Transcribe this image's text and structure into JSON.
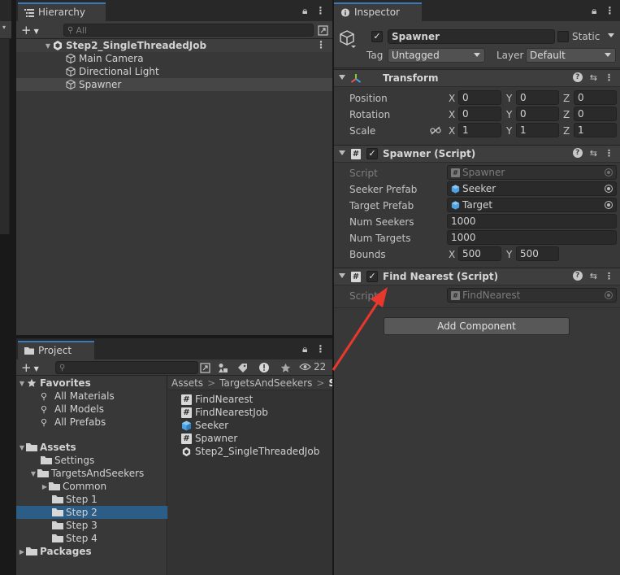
{
  "hierarchy": {
    "tab_label": "Hierarchy",
    "search_placeholder": "All",
    "items": [
      {
        "label": "Step2_SingleThreadedJob"
      },
      {
        "label": "Main Camera"
      },
      {
        "label": "Directional Light"
      },
      {
        "label": "Spawner"
      }
    ]
  },
  "project": {
    "tab_label": "Project",
    "search_placeholder": "",
    "hidden_count": "22",
    "tree": {
      "favorites": "Favorites",
      "all_materials": "All Materials",
      "all_models": "All Models",
      "all_prefabs": "All Prefabs",
      "assets": "Assets",
      "settings": "Settings",
      "targets_and_seekers": "TargetsAndSeekers",
      "common": "Common",
      "step1": "Step 1",
      "step2": "Step 2",
      "step3": "Step 3",
      "step4": "Step 4",
      "packages": "Packages"
    },
    "breadcrumb": [
      "Assets",
      "TargetsAndSeekers",
      "St"
    ],
    "files": [
      {
        "label": "FindNearest"
      },
      {
        "label": "FindNearestJob"
      },
      {
        "label": "Seeker"
      },
      {
        "label": "Spawner"
      },
      {
        "label": "Step2_SingleThreadedJob"
      }
    ]
  },
  "inspector": {
    "tab_label": "Inspector",
    "object_name": "Spawner",
    "static_label": "Static",
    "tag_label": "Tag",
    "tag_value": "Untagged",
    "layer_label": "Layer",
    "layer_value": "Default",
    "transform": {
      "title": "Transform",
      "position_label": "Position",
      "rotation_label": "Rotation",
      "scale_label": "Scale",
      "axis_x": "X",
      "axis_y": "Y",
      "axis_z": "Z",
      "position": [
        "0",
        "0",
        "0"
      ],
      "rotation": [
        "0",
        "0",
        "0"
      ],
      "scale": [
        "1",
        "1",
        "1"
      ]
    },
    "spawner": {
      "title": "Spawner (Script)",
      "script_label": "Script",
      "script_value": "Spawner",
      "seeker_prefab_label": "Seeker Prefab",
      "seeker_prefab_value": "Seeker",
      "target_prefab_label": "Target Prefab",
      "target_prefab_value": "Target",
      "num_seekers_label": "Num Seekers",
      "num_seekers_value": "1000",
      "num_targets_label": "Num Targets",
      "num_targets_value": "1000",
      "bounds_label": "Bounds",
      "bounds_x": "500",
      "bounds_y": "500"
    },
    "find_nearest": {
      "title": "Find Nearest (Script)",
      "script_label": "Script",
      "script_value": "FindNearest"
    },
    "add_component": "Add Component"
  },
  "colors": {
    "selection": "#2c5d87",
    "tab_accent": "#3a79bb",
    "annotation_arrow": "#e8382e"
  }
}
